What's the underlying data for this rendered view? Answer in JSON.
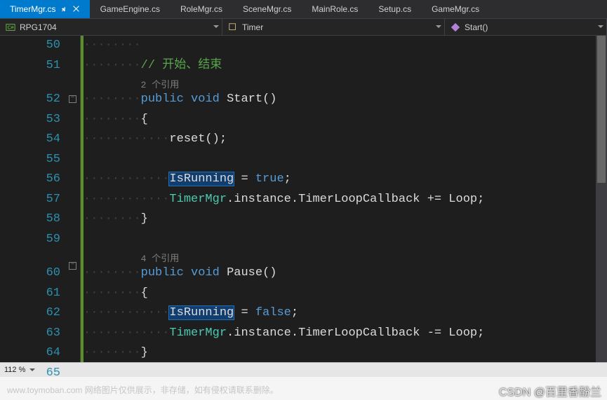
{
  "tabs": [
    {
      "label": "TimerMgr.cs",
      "active": true,
      "pinned": true
    },
    {
      "label": "GameEngine.cs",
      "active": false
    },
    {
      "label": "RoleMgr.cs",
      "active": false
    },
    {
      "label": "SceneMgr.cs",
      "active": false
    },
    {
      "label": "MainRole.cs",
      "active": false
    },
    {
      "label": "Setup.cs",
      "active": false
    },
    {
      "label": "GameMgr.cs",
      "active": false
    }
  ],
  "breadcrumbs": {
    "project": "RPG1704",
    "class": "Timer",
    "member": "Start()"
  },
  "line_numbers": [
    "50",
    "51",
    "",
    "52",
    "53",
    "54",
    "55",
    "56",
    "57",
    "58",
    "59",
    "",
    "60",
    "61",
    "62",
    "63",
    "64",
    "65"
  ],
  "code": {
    "comment_start": "// 开始、结束",
    "ref1": "2 个引用",
    "kw_public1": "public",
    "kw_void1": "void",
    "fn_start": "Start",
    "parens": "()",
    "brace_open": "{",
    "call_reset": "reset();",
    "id_isRunning1": "IsRunning",
    "assign_true": " = ",
    "kw_true": "true",
    "semi": ";",
    "type_timerMgr1": "TimerMgr",
    "tm_rest1": ".instance.TimerLoopCallback += Loop;",
    "brace_close": "}",
    "ref2": "4 个引用",
    "kw_public2": "public",
    "kw_void2": "void",
    "fn_pause": "Pause",
    "id_isRunning2": "IsRunning",
    "kw_false": "false",
    "type_timerMgr2": "TimerMgr",
    "tm_rest2": ".instance.TimerLoopCallback -= Loop;"
  },
  "status": {
    "zoom": "112 %"
  },
  "watermark": "CSDN @百里香酚兰",
  "footer": "www.toymoban.com 网络图片仅供展示，非存储，如有侵权请联系删除。"
}
